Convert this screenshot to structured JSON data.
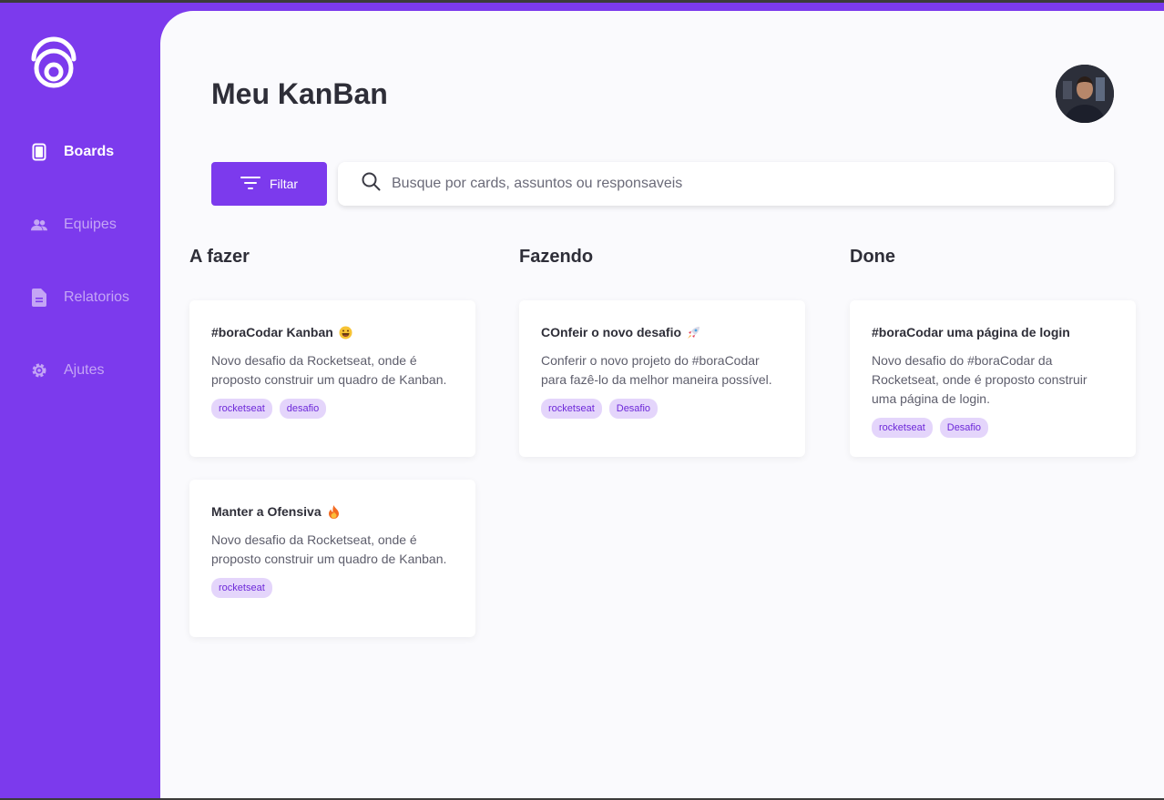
{
  "app": {
    "title": "Meu KanBan"
  },
  "colors": {
    "accent": "#7c3aed",
    "tag_bg": "#e4d5fb",
    "tag_text": "#6d28d9",
    "background": "#fafafd"
  },
  "sidebar": {
    "items": [
      {
        "label": "Boards",
        "icon": "tablet-icon",
        "active": true
      },
      {
        "label": "Equipes",
        "icon": "users-icon",
        "active": false
      },
      {
        "label": "Relatorios",
        "icon": "document-icon",
        "active": false
      },
      {
        "label": "Ajutes",
        "icon": "gear-icon",
        "active": false
      }
    ]
  },
  "toolbar": {
    "filter_label": "Filtar",
    "search_placeholder": "Busque por cards, assuntos ou responsaveis"
  },
  "columns": [
    {
      "title": "A fazer",
      "cards": [
        {
          "title": "#boraCodar Kanban",
          "emoji": "grinning-face-icon",
          "description": "Novo desafio da Rocketseat, onde é proposto construir um quadro de Kanban.",
          "tags": [
            "rocketseat",
            "desafio"
          ]
        },
        {
          "title": "Manter a Ofensiva",
          "emoji": "fire-icon",
          "description": "Novo desafio da Rocketseat, onde é proposto construir um quadro de Kanban.",
          "tags": [
            "rocketseat"
          ]
        }
      ]
    },
    {
      "title": "Fazendo",
      "cards": [
        {
          "title": "COnfeir o novo desafio",
          "emoji": "rocket-icon",
          "description": "Conferir o novo projeto do #boraCodar para fazê-lo da melhor maneira possível.",
          "tags": [
            "rocketseat",
            "Desafio"
          ]
        }
      ]
    },
    {
      "title": "Done",
      "cards": [
        {
          "title": "#boraCodar uma página de login",
          "emoji": "",
          "description": "Novo desafio do #boraCodar da Rocketseat, onde é proposto construir uma página de login.",
          "tags": [
            "rocketseat",
            "Desafio"
          ]
        }
      ]
    }
  ]
}
